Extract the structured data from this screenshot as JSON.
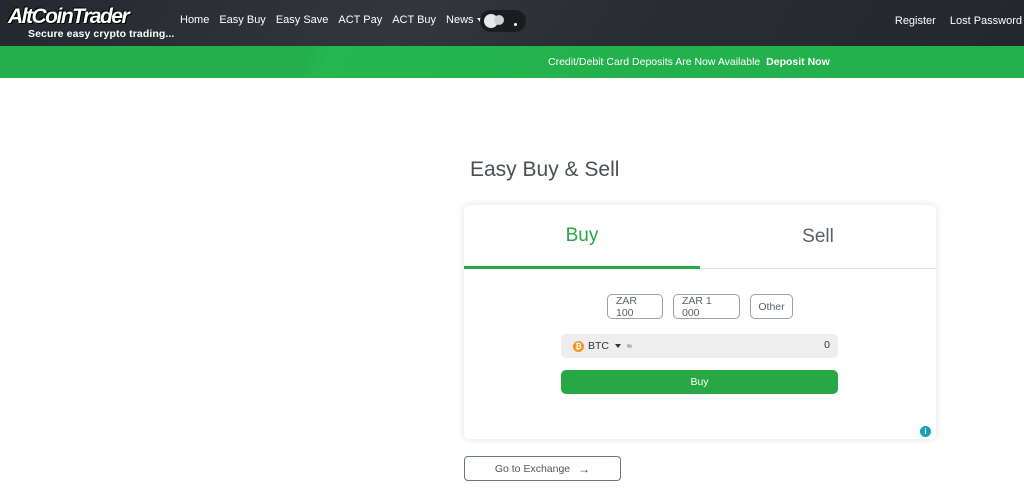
{
  "brand": {
    "logo_text": "AltCoinTrader",
    "tagline": "Secure easy crypto trading..."
  },
  "nav": {
    "links": [
      "Home",
      "Easy Buy",
      "Easy Save",
      "ACT Pay",
      "ACT Buy",
      "News"
    ],
    "right_links": [
      "Register",
      "Lost Password"
    ]
  },
  "promo": {
    "text": "Credit/Debit Card Deposits Are Now Available",
    "link": "Deposit Now"
  },
  "page": {
    "title": "Easy Buy & Sell"
  },
  "trade": {
    "tabs": [
      "Buy",
      "Sell"
    ],
    "active_tab": "Buy",
    "quick_amounts": [
      "ZAR 100",
      "ZAR 1 000",
      "Other"
    ],
    "coin": "BTC",
    "coin_symbol": "₿",
    "approx": "≈",
    "amount": "0",
    "buy_label": "Buy",
    "info_symbol": "i"
  },
  "footer": {
    "exchange_label": "Go to Exchange",
    "exchange_arrow": "→"
  },
  "colors": {
    "navbar": "#2a2d33",
    "promo": "#22b14c",
    "accent": "#28a745",
    "bitcoin": "#f7931a",
    "info": "#17a2b8"
  }
}
